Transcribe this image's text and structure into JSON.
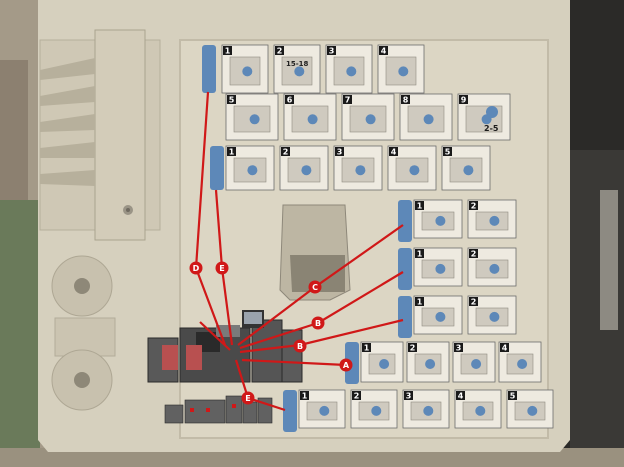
{
  "photo": {
    "subject": "printer-service-door-jam-clearance-panel",
    "colors": {
      "wall": "#a49a88",
      "floor": "#6a7a5a",
      "panel": "#d6d0be",
      "panel_shadow": "#b9b2a0",
      "route_line": "#d01818",
      "step_box": "#eeeae0",
      "step_outline": "#6c6c6c",
      "tab_blue": "#5d88b8",
      "machine_dark": "#2a2a2a",
      "machine_mid": "#595959"
    }
  },
  "callouts": {
    "a": "A",
    "b": "B",
    "c": "C",
    "d": "D",
    "e": "E"
  },
  "step_numbers": {
    "row1": [
      "1",
      "2",
      "3",
      "4"
    ],
    "row1_tag": "15-18",
    "row2": [
      "5",
      "6",
      "7",
      "8",
      "9"
    ],
    "row2_range": "2-5",
    "row3": [
      "1",
      "2",
      "3",
      "4",
      "5"
    ],
    "rightC": [
      "1",
      "2"
    ],
    "rightB": [
      "1",
      "2"
    ],
    "rightBb": [
      "1",
      "2"
    ],
    "rightA": [
      "1",
      "2",
      "3",
      "4"
    ],
    "bottom": [
      "1",
      "2",
      "3",
      "4",
      "5"
    ]
  }
}
